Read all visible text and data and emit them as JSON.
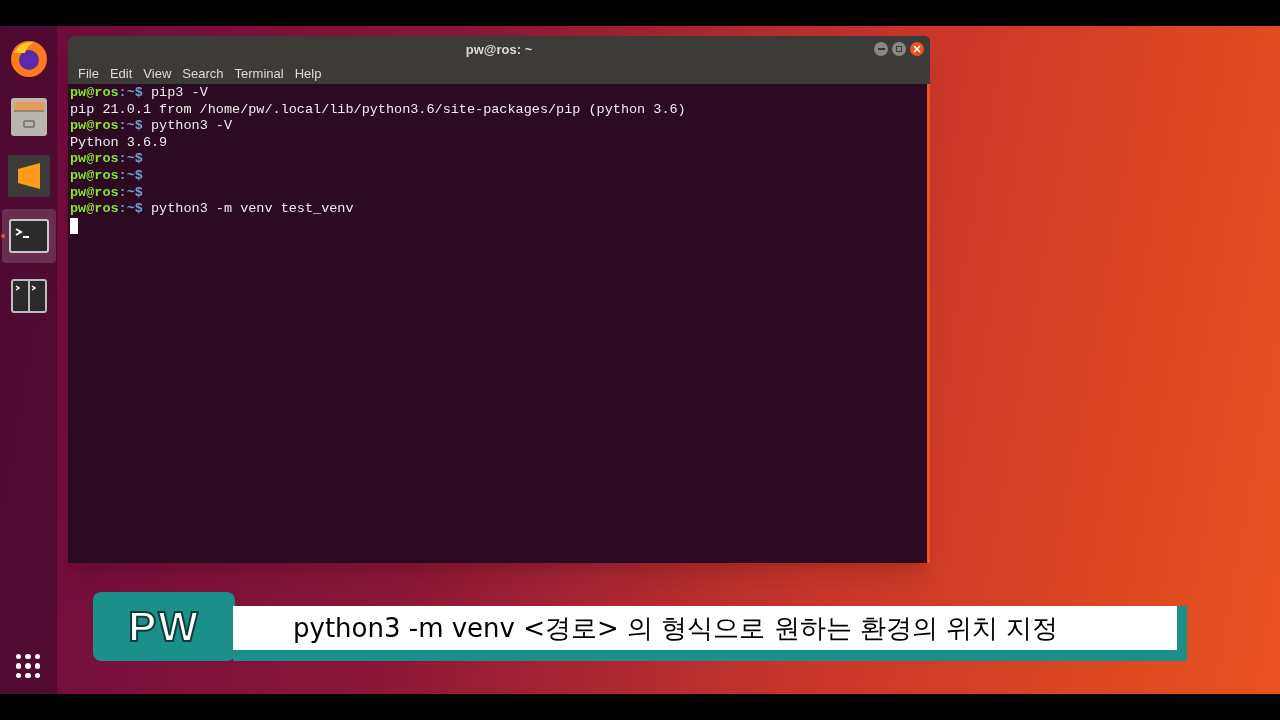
{
  "dock": {
    "items": [
      {
        "kind": "firefox",
        "selected": false,
        "running": false
      },
      {
        "kind": "files",
        "selected": false,
        "running": false
      },
      {
        "kind": "editor",
        "selected": false,
        "running": false
      },
      {
        "kind": "terminal",
        "selected": true,
        "running": true
      },
      {
        "kind": "split-terminal",
        "selected": false,
        "running": false
      }
    ]
  },
  "window": {
    "title": "pw@ros: ~",
    "menu": [
      "File",
      "Edit",
      "View",
      "Search",
      "Terminal",
      "Help"
    ],
    "lines": [
      {
        "kind": "prompt",
        "user_host": "pw@ros",
        "path": ":~$",
        "command": "pip3 -V"
      },
      {
        "kind": "output",
        "text": "pip 21.0.1 from /home/pw/.local/lib/python3.6/site-packages/pip (python 3.6)"
      },
      {
        "kind": "prompt",
        "user_host": "pw@ros",
        "path": ":~$",
        "command": "python3 -V"
      },
      {
        "kind": "output",
        "text": "Python 3.6.9"
      },
      {
        "kind": "prompt",
        "user_host": "pw@ros",
        "path": ":~$"
      },
      {
        "kind": "prompt",
        "user_host": "pw@ros",
        "path": ":~$"
      },
      {
        "kind": "prompt",
        "user_host": "pw@ros",
        "path": ":~$"
      },
      {
        "kind": "prompt",
        "user_host": "pw@ros",
        "path": ":~$",
        "command": "python3 -m venv test_venv"
      },
      {
        "kind": "cursor"
      }
    ]
  },
  "caption": {
    "badge": "PW",
    "text": "python3 -m venv <경로> 의 형식으로 원하는 환경의 위치 지정"
  }
}
